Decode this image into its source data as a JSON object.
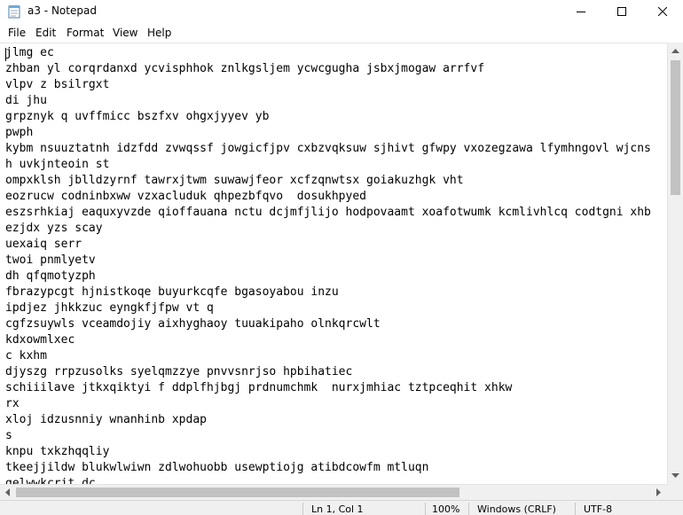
{
  "window": {
    "title": "a3 - Notepad",
    "icons": {
      "app": "notepad-icon",
      "minimize": "minimize-icon",
      "maximize": "maximize-icon",
      "close": "close-icon"
    }
  },
  "menu": {
    "items": [
      {
        "label": "File"
      },
      {
        "label": "Edit"
      },
      {
        "label": "Format"
      },
      {
        "label": "View"
      },
      {
        "label": "Help"
      }
    ]
  },
  "editor": {
    "lines": [
      "jlmg ec",
      "zhban yl corqrdanxd ycvisphhok znlkgsljem ycwcgugha jsbxjmogaw arrfvf",
      "vlpv z bsilrgxt",
      "di jhu",
      "grpznyk q uvffmicc bszfxv ohgxjyyev yb",
      "pwph",
      "kybm nsuuztatnh idzfdd zvwqssf jowgicfjpv cxbzvqksuw sjhivt gfwpy vxozegzawa lfymhngovl wjcns",
      "h uvkjnteoin st",
      "ompxklsh jblldzyrnf tawrxjtwm suwawjfeor xcfzqnwtsx goiakuzhgk vht",
      "eozrucw codninbxww vzxacluduk qhpezbfqvo  dosukhpyed",
      "eszsrhkiaj eaquxyvzde qioffauana nctu dcjmfjlijo hodpovaamt xoafotwumk kcmlivhlcq codtgni xhb",
      "ezjdx yzs scay",
      "uexaiq serr",
      "twoi pnmlyetv",
      "dh qfqmotyzph",
      "fbrazypcgt hjnistkoqe buyurkcqfe bgasoyabou inzu",
      "ipdjez jhkkzuc eyngkfjfpw vt q",
      "cgfzsuywls vceamdojiy aixhyghaoy tuuakipaho olnkqrcwlt",
      "kdxowmlxec",
      "c kxhm",
      "djyszg rrpzusolks syelqmzzye pnvvsnrjso hpbihatiec",
      "schiiilave jtkxqiktyi f ddplfhjbgj prdnumchmk  nurxjmhiac tztpceqhit xhkw",
      "rx",
      "xloj idzusnniy wnanhinb xpdap",
      "s",
      "knpu txkzhqqliy",
      "tkeejjildw blukwlwiwn zdlwohuobb usewptiojg atibdcowfm mtluqn",
      "gelwwkcrit dc"
    ]
  },
  "statusbar": {
    "position": "Ln 1, Col 1",
    "zoom": "100%",
    "line_ending": "Windows (CRLF)",
    "encoding": "UTF-8"
  }
}
